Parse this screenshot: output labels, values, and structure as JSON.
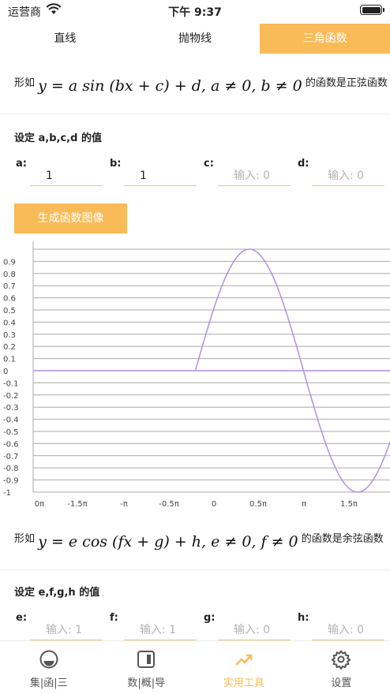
{
  "status": {
    "carrier": "运营商",
    "time": "下午 9:37"
  },
  "tabs": [
    {
      "label": "直线",
      "active": false
    },
    {
      "label": "抛物线",
      "active": false
    },
    {
      "label": "三角函数",
      "active": true
    }
  ],
  "sine": {
    "prefix": "形如",
    "formula": "y = a sin (bx + c) + d, a ≠ 0, b ≠ 0",
    "suffix": "的函数是正弦函数",
    "set_label": "设定 a,b,c,d 的值",
    "params": [
      {
        "label": "a:",
        "value": "1",
        "placeholder": "输入: 0"
      },
      {
        "label": "b:",
        "value": "1",
        "placeholder": "输入: 0"
      },
      {
        "label": "c:",
        "value": "",
        "placeholder": "输入: 0"
      },
      {
        "label": "d:",
        "value": "",
        "placeholder": "输入: 0"
      }
    ],
    "generate_label": "生成函数图像"
  },
  "chart_data": {
    "type": "line",
    "series": [
      {
        "function": "sin(x)",
        "color": "#b18ee6"
      }
    ],
    "xlim": [
      -1.5,
      1.8
    ],
    "ylim": [
      -1,
      1
    ],
    "x_tick_labels": [
      "0π",
      "-1.5π",
      "-π",
      "-0.5π",
      "0",
      "0.5π",
      "π",
      "1.5π"
    ],
    "y_tick_labels": [
      "0.9",
      "0.8",
      "0.7",
      "0.6",
      "0.5",
      "0.4",
      "0.3",
      "0.2",
      "0.1",
      "0",
      "-0.1",
      "-0.2",
      "-0.3",
      "-0.4",
      "-0.5",
      "-0.6",
      "-0.7",
      "-0.8",
      "-0.9",
      "-1"
    ],
    "grid": true,
    "line_color": "#b18ee6",
    "grid_color": "#aaaaaa"
  },
  "cosine": {
    "prefix": "形如",
    "formula": "y = e cos (fx + g) + h, e ≠ 0, f ≠ 0",
    "suffix": "的函数是余弦函数",
    "set_label": "设定 e,f,g,h 的值",
    "params": [
      {
        "label": "e:",
        "value": "",
        "placeholder": "输入: 1"
      },
      {
        "label": "f:",
        "value": "",
        "placeholder": "输入: 1"
      },
      {
        "label": "g:",
        "value": "",
        "placeholder": "输入: 0"
      },
      {
        "label": "h:",
        "value": "",
        "placeholder": "输入: 0"
      }
    ]
  },
  "bottom_nav": [
    {
      "label": "集|函|三",
      "icon": "circle-half-icon",
      "active": false
    },
    {
      "label": "数|概|导",
      "icon": "panel-icon",
      "active": false
    },
    {
      "label": "实用工具",
      "icon": "trend-icon",
      "active": true
    },
    {
      "label": "设置",
      "icon": "gear-icon",
      "active": false
    }
  ],
  "colors": {
    "accent": "#f8bb57",
    "curve": "#b18ee6"
  }
}
